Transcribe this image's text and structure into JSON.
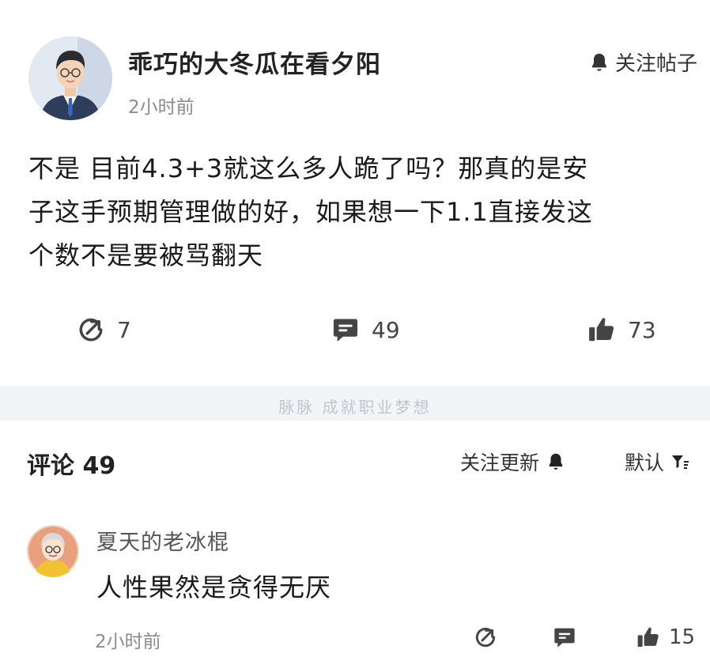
{
  "post": {
    "author_name": "乖巧的大冬瓜在看夕阳",
    "time": "2小时前",
    "follow_label": "关注帖子",
    "body_lines": [
      "不是  目前4.3+3就这么多人跪了吗？那真的是安",
      "子这手预期管理做的好，如果想一下1.1直接发这",
      "个数不是要被骂翻天"
    ],
    "actions": {
      "share_count": "7",
      "comment_count": "49",
      "like_count": "73"
    },
    "icons": [
      "avatar-man-suit",
      "bell-icon",
      "share-icon",
      "comment-icon",
      "thumb-up-icon"
    ]
  },
  "watermark": "脉脉  成就职业梦想",
  "comments_header": {
    "title": "评论 49",
    "follow_updates_label": "关注更新",
    "sort_label": "默认"
  },
  "comments": [
    {
      "name": "夏天的老冰棍",
      "text": "人性果然是贪得无厌",
      "time": "2小时前",
      "like_count": "15"
    }
  ],
  "colors": {
    "text_primary": "#1a1a1a",
    "text_secondary": "#8c8c8c",
    "band": "#f3f4f7",
    "icon": "#444444"
  }
}
